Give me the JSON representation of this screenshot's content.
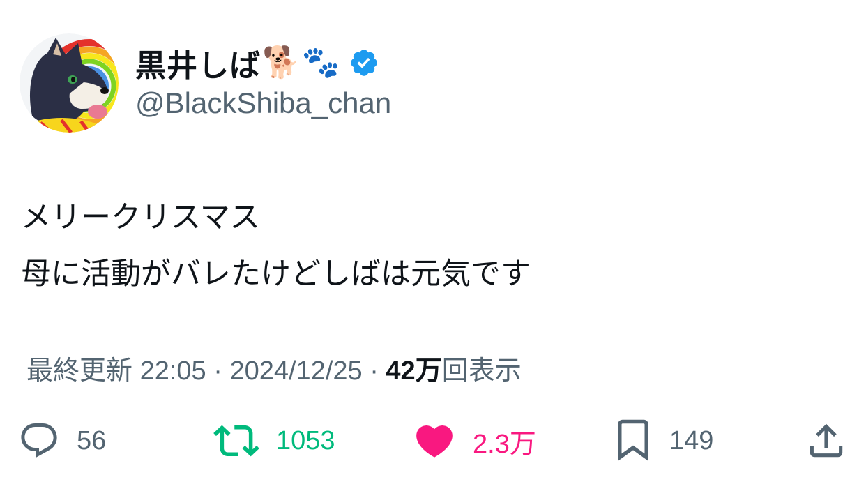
{
  "user": {
    "display_name": "黒井しば",
    "emoji_dog": "🐕",
    "emoji_paws": "🐾",
    "handle": "@BlackShiba_chan",
    "verified": true
  },
  "tweet": {
    "lines": [
      "メリークリスマス",
      "母に活動がバレたけどしばは元気です"
    ]
  },
  "meta": {
    "prefix": "最終更新",
    "time": "22:05",
    "separator": " · ",
    "date": "2024/12/25",
    "separator2": " · ",
    "views_count": "42万",
    "views_label": "回表示"
  },
  "actions": {
    "replies": "56",
    "retweets": "1053",
    "likes": "2.3万",
    "bookmarks": "149"
  },
  "colors": {
    "text": "#0f1419",
    "secondary": "#536471",
    "verified": "#1d9bf0",
    "retweet": "#00ba7c",
    "like": "#f91880"
  },
  "icons": [
    "reply-icon",
    "retweet-icon",
    "heart-icon",
    "bookmark-icon",
    "share-icon",
    "verified-badge-icon"
  ]
}
